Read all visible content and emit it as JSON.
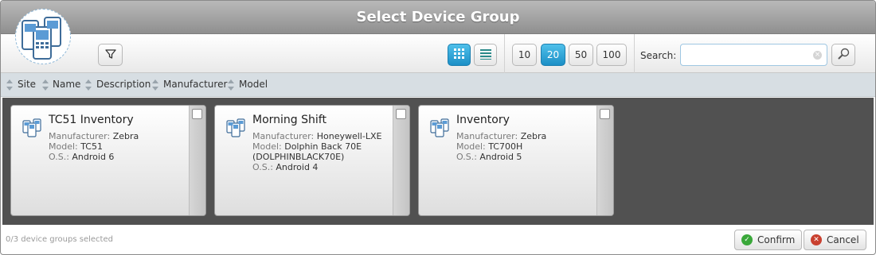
{
  "dialog": {
    "title": "Select Device Group"
  },
  "toolbar": {
    "view_modes": [
      {
        "name": "grid-view-icon",
        "active": true
      },
      {
        "name": "list-view-icon",
        "active": false
      }
    ],
    "page_sizes": [
      "10",
      "20",
      "50",
      "100"
    ],
    "page_size_selected": "20",
    "search_label": "Search:",
    "search_value": "",
    "search_placeholder": ""
  },
  "columns": [
    "Site",
    "Name",
    "Description",
    "Manufacturer",
    "Model"
  ],
  "groups": [
    {
      "name": "TC51 Inventory",
      "manufacturer_label": "Manufacturer:",
      "manufacturer": "Zebra",
      "model_label": "Model:",
      "model": "TC51",
      "os_label": "O.S.:",
      "os": "Android 6"
    },
    {
      "name": "Morning Shift",
      "manufacturer_label": "Manufacturer:",
      "manufacturer": "Honeywell-LXE",
      "model_label": "Model:",
      "model": "Dolphin Back 70E (DOLPHINBLACK70E)",
      "os_label": "O.S.:",
      "os": "Android 4"
    },
    {
      "name": "Inventory",
      "manufacturer_label": "Manufacturer:",
      "manufacturer": "Zebra",
      "model_label": "Model:",
      "model": "TC700H",
      "os_label": "O.S.:",
      "os": "Android 5"
    }
  ],
  "footer": {
    "status": "0/3 device groups selected",
    "confirm_label": "Confirm",
    "cancel_label": "Cancel"
  },
  "colors": {
    "accent": "#1c8fc6",
    "confirm_icon": "#3aa83a",
    "cancel_icon": "#c9402f"
  }
}
